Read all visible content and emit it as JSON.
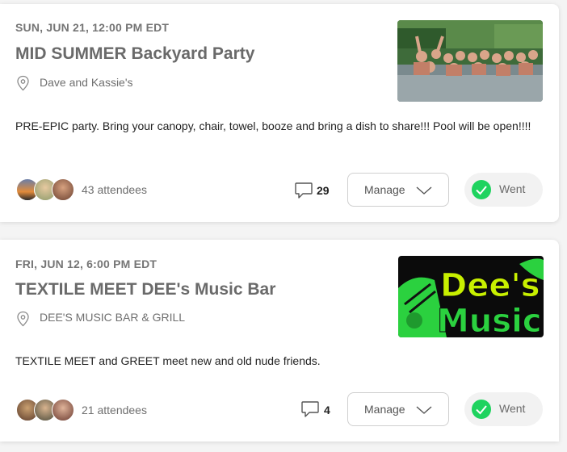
{
  "events": [
    {
      "date": "SUN, JUN 21, 12:00 PM EDT",
      "title": "MID SUMMER Backyard Party",
      "location": "Dave and Kassie's",
      "description": "PRE-EPIC party. Bring your canopy, chair, towel, booze and bring a dish to share!!! Pool will be open!!!!",
      "attendees": "43 attendees",
      "comments": "29",
      "manage_label": "Manage",
      "went_label": "Went",
      "thumb_icon": "pool-party-photo"
    },
    {
      "date": "FRI, JUN 12, 6:00 PM EDT",
      "title": "TEXTILE MEET DEE's Music Bar",
      "location": "DEE'S MUSIC BAR & GRILL",
      "description": "TEXTILE MEET and GREET meet new and old nude friends.",
      "attendees": "21 attendees",
      "comments": "4",
      "manage_label": "Manage",
      "went_label": "Went",
      "thumb_logo_text_1": "Dee's",
      "thumb_logo_text_2": "Music"
    }
  ],
  "colors": {
    "went_green": "#1fd35f",
    "logo_yellow": "#c8f000",
    "logo_green": "#2bd13f"
  }
}
